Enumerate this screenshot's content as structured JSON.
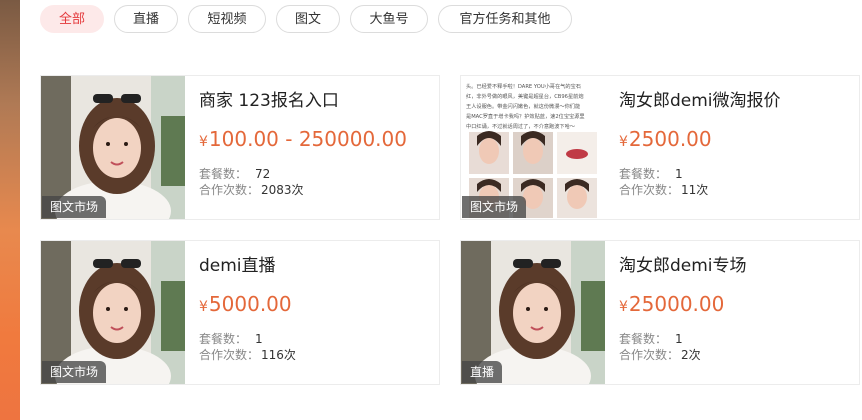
{
  "tabs": [
    {
      "label": "全部",
      "active": true
    },
    {
      "label": "直播",
      "active": false
    },
    {
      "label": "短视频",
      "active": false
    },
    {
      "label": "图文",
      "active": false
    },
    {
      "label": "大鱼号",
      "active": false
    },
    {
      "label": "官方任务和其他",
      "active": false
    }
  ],
  "cards": [
    {
      "tag": "图文市场",
      "title": "商家 123报名入口",
      "currency": "¥",
      "price": "100.00 - 250000.00",
      "packages_label": "套餐数：",
      "packages": "72",
      "coop_label": "合作次数：",
      "coop": "2083次",
      "thumb": "portrait"
    },
    {
      "tag": "图文市场",
      "title": "淘女郎demi微淘报价",
      "currency": "¥",
      "price": "2500.00",
      "packages_label": "套餐数：",
      "packages": "1",
      "coop_label": "合作次数：",
      "coop": "11次",
      "thumb": "collage",
      "thumb_text": [
        "头。已经爱不释手啦！DARE YOU小哥在气的宝石",
        "红，非外号做的眼风，美键是超星台，CB96星前炮",
        "王人设服色。带金闪闪嫩色，就这份微漫～你们能",
        "是MAC罗直于增卡我吗？护效贴蓝，速2位宝宝源里",
        "中口红诵，不过就话周过了，不介意跑波下哈～"
      ]
    },
    {
      "tag": "图文市场",
      "title": "demi直播",
      "currency": "¥",
      "price": "5000.00",
      "packages_label": "套餐数：",
      "packages": "1",
      "coop_label": "合作次数：",
      "coop": "116次",
      "thumb": "portrait"
    },
    {
      "tag": "直播",
      "title": "淘女郎demi专场",
      "currency": "¥",
      "price": "25000.00",
      "packages_label": "套餐数：",
      "packages": "1",
      "coop_label": "合作次数：",
      "coop": "2次",
      "thumb": "portrait"
    }
  ],
  "colors": {
    "accent": "#e4393c",
    "price": "#e4683a",
    "tag_bg": "#464646"
  }
}
